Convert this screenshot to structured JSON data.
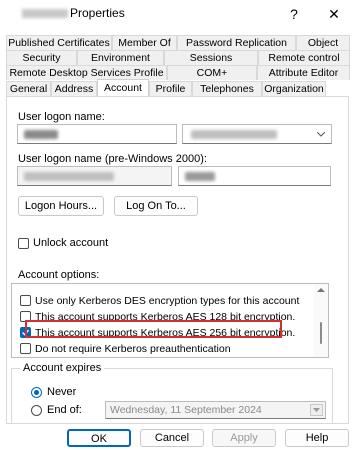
{
  "window": {
    "title": "Properties"
  },
  "titlebar": {
    "help_glyph": "?",
    "close_glyph": "✕"
  },
  "tabs_row1": [
    "Published Certificates",
    "Member Of",
    "Password Replication",
    "Object"
  ],
  "tabs_row2": [
    "Security",
    "Environment",
    "Sessions",
    "Remote control"
  ],
  "tabs_row3": [
    "Remote Desktop Services Profile",
    "COM+",
    "Attribute Editor"
  ],
  "tabs_row4": [
    "General",
    "Address",
    "Account",
    "Profile",
    "Telephones",
    "Organization"
  ],
  "active_tab": "Account",
  "account": {
    "logon_name_label": "User logon name:",
    "logon_name_pre2000_label": "User logon name (pre-Windows 2000):",
    "logon_hours_button": "Logon Hours...",
    "log_on_to_button": "Log On To...",
    "unlock_label": "Unlock account",
    "options_label": "Account options:",
    "options": [
      {
        "label": "Use only Kerberos DES encryption types for this account",
        "checked": false,
        "highlighted": false
      },
      {
        "label": "This account supports Kerberos AES 128 bit encryption.",
        "checked": false,
        "highlighted": false
      },
      {
        "label": "This account supports Kerberos AES 256 bit encryption.",
        "checked": true,
        "highlighted": true
      },
      {
        "label": "Do not require Kerberos preauthentication",
        "checked": false,
        "highlighted": false
      }
    ],
    "expires_label": "Account expires",
    "never_label": "Never",
    "end_of_label": "End of:",
    "end_of_date": "Wednesday, 11 September 2024"
  },
  "dialog_buttons": {
    "ok": "OK",
    "cancel": "Cancel",
    "apply": "Apply",
    "help": "Help"
  },
  "colors": {
    "accent": "#0067c0",
    "highlight_border": "#d32f2f"
  }
}
